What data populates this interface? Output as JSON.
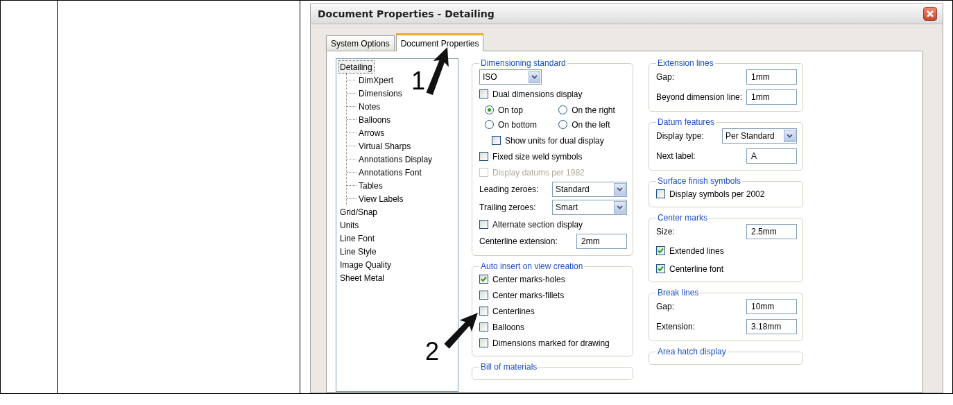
{
  "window": {
    "title": "Document Properties - Detailing"
  },
  "tabs": [
    {
      "label": "System Options",
      "selected": false
    },
    {
      "label": "Document Properties",
      "selected": true
    }
  ],
  "tree": [
    {
      "label": "Detailing",
      "selected": true,
      "children": [
        {
          "label": "DimXpert",
          "selected": false
        },
        {
          "label": "Dimensions",
          "selected": false
        },
        {
          "label": "Notes",
          "selected": false
        },
        {
          "label": "Balloons",
          "selected": false
        },
        {
          "label": "Arrows",
          "selected": false
        },
        {
          "label": "Virtual Sharps",
          "selected": false
        },
        {
          "label": "Annotations Display",
          "selected": false
        },
        {
          "label": "Annotations Font",
          "selected": false
        },
        {
          "label": "Tables",
          "selected": false
        },
        {
          "label": "View Labels",
          "selected": false
        }
      ]
    },
    {
      "label": "Grid/Snap",
      "selected": false
    },
    {
      "label": "Units",
      "selected": false
    },
    {
      "label": "Line Font",
      "selected": false
    },
    {
      "label": "Line Style",
      "selected": false
    },
    {
      "label": "Image Quality",
      "selected": false
    },
    {
      "label": "Sheet Metal",
      "selected": false
    }
  ],
  "group_columns": [
    {
      "groups": [
        {
          "title": "Dimensioning standard",
          "rows": [
            {
              "kind": "select",
              "value": "ISO"
            },
            {
              "kind": "checkbox",
              "label": "Dual dimensions display",
              "checked": false,
              "disabled": false
            },
            {
              "kind": "radios",
              "options": [
                {
                  "label": "On top",
                  "selected": true
                },
                {
                  "label": "On the right",
                  "selected": false
                },
                {
                  "label": "On bottom",
                  "selected": false
                },
                {
                  "label": "On the left",
                  "selected": false
                }
              ]
            },
            {
              "kind": "sub_checkbox",
              "label": "Show units for dual display",
              "checked": false,
              "disabled": false
            },
            {
              "kind": "checkbox",
              "label": "Fixed size weld symbols",
              "checked": false,
              "disabled": false
            },
            {
              "kind": "checkbox",
              "label": "Display datums per 1982",
              "checked": false,
              "disabled": true
            },
            {
              "kind": "labeled_select",
              "label": "Leading zeroes:",
              "value": "Standard"
            },
            {
              "kind": "labeled_select",
              "label": "Trailing zeroes:",
              "value": "Smart"
            },
            {
              "kind": "checkbox",
              "label": "Alternate section display",
              "checked": false,
              "disabled": false
            },
            {
              "kind": "labeled_field",
              "label": "Centerline extension:",
              "value": "2mm"
            }
          ]
        },
        {
          "title": "Auto insert on view creation",
          "rows": [
            {
              "kind": "checkbox",
              "label": "Center marks-holes",
              "checked": true,
              "disabled": false
            },
            {
              "kind": "checkbox",
              "label": "Center marks-fillets",
              "checked": false,
              "disabled": false
            },
            {
              "kind": "checkbox",
              "label": "Centerlines",
              "checked": false,
              "disabled": false
            },
            {
              "kind": "checkbox",
              "label": "Balloons",
              "checked": false,
              "disabled": false
            },
            {
              "kind": "checkbox",
              "label": "Dimensions marked for drawing",
              "checked": false,
              "disabled": false
            }
          ]
        },
        {
          "title": "Bill of materials"
        }
      ]
    },
    {
      "groups": [
        {
          "title": "Extension lines",
          "rows": [
            {
              "kind": "labeled_field",
              "label": "Gap:",
              "value": "1mm"
            },
            {
              "kind": "labeled_field",
              "label": "Beyond dimension line:",
              "value": "1mm"
            }
          ]
        },
        {
          "title": "Datum features",
          "rows": [
            {
              "kind": "labeled_select",
              "label": "Display type:",
              "value": "Per Standard"
            },
            {
              "kind": "labeled_field",
              "label": "Next label:",
              "value": "A"
            }
          ]
        },
        {
          "title": "Surface finish symbols",
          "rows": [
            {
              "kind": "checkbox",
              "label": "Display symbols per 2002",
              "checked": false,
              "disabled": false
            }
          ]
        },
        {
          "title": "Center marks",
          "rows": [
            {
              "kind": "labeled_field",
              "label": "Size:",
              "value": "2.5mm"
            },
            {
              "kind": "checkbox",
              "label": "Extended lines",
              "checked": true,
              "disabled": false
            },
            {
              "kind": "checkbox",
              "label": "Centerline font",
              "checked": true,
              "disabled": false
            }
          ]
        },
        {
          "title": "Break lines",
          "rows": [
            {
              "kind": "labeled_field",
              "label": "Gap:",
              "value": "10mm"
            },
            {
              "kind": "labeled_field",
              "label": "Extension:",
              "value": "3.18mm"
            }
          ]
        },
        {
          "title": "Area hatch display"
        }
      ]
    }
  ],
  "annotations": [
    {
      "label": "1"
    },
    {
      "label": "2"
    }
  ]
}
